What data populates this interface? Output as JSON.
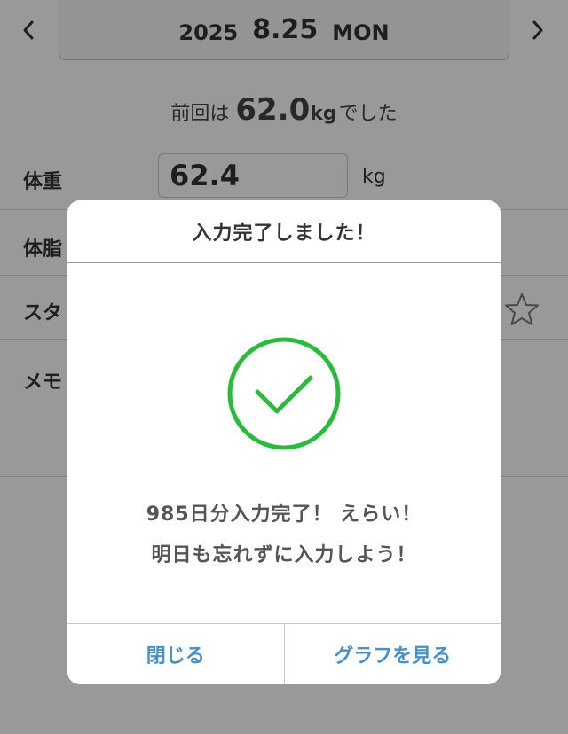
{
  "header": {
    "prev_icon": "chevron-left-icon",
    "next_icon": "chevron-right-icon",
    "year": "2025",
    "month_day": "8.25",
    "weekday": "MON"
  },
  "previous": {
    "prefix": "前回は",
    "value": "62.0",
    "unit": "kg",
    "suffix": "でした"
  },
  "rows": {
    "weight_label": "体重",
    "weight_value": "62.4",
    "weight_unit": "kg",
    "bodyfat_label": "体脂",
    "stamp_label": "スタ",
    "stamp_icon": "star-outline-icon",
    "memo_label": "メモ"
  },
  "modal": {
    "title": "入力完了しました！",
    "check_icon": "check-circle-icon",
    "message_line1": "985日分入力完了！ えらい！",
    "message_line2": "明日も忘れずに入力しよう！",
    "close_label": "閉じる",
    "graph_label": "グラフを見る"
  },
  "colors": {
    "accent_green": "#2bbb3c",
    "button_blue": "#4a90c2",
    "overlay": "rgba(0,0,0,0.40)"
  }
}
